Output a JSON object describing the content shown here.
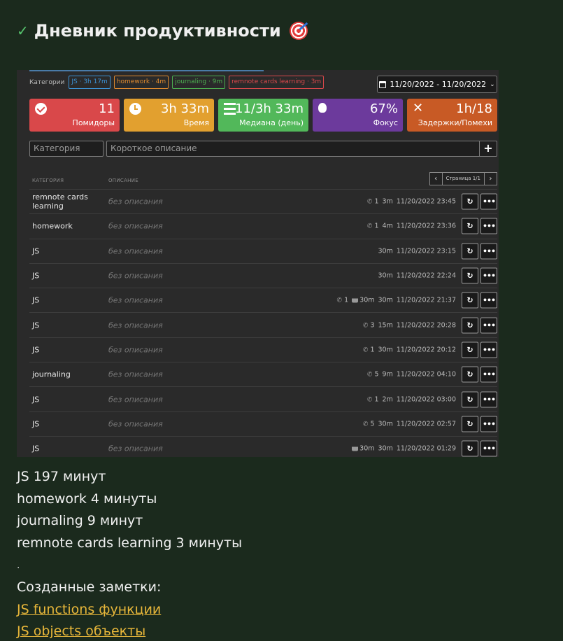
{
  "page": {
    "title": "Дневник продуктивности",
    "check_icon": "check-icon",
    "emoji_icon": "target-icon"
  },
  "app": {
    "categories_label": "Категории",
    "chips": [
      {
        "label": "JS · 3h 17m",
        "color": "#3d93d6"
      },
      {
        "label": "homework · 4m",
        "color": "#e08a2e"
      },
      {
        "label": "journaling · 9m",
        "color": "#4caf50"
      },
      {
        "label": "remnote cards learning · 3m",
        "color": "#d9484a"
      }
    ],
    "date_range": "11/20/2022 - 11/20/2022",
    "stats": [
      {
        "value": "11",
        "label": "Помидоры",
        "icon": "check-circle-icon",
        "color": "#d9484a"
      },
      {
        "value": "3h 33m",
        "label": "Время",
        "icon": "clock-icon",
        "color": "#e2a02f"
      },
      {
        "value": "11/3h 33m",
        "label": "Медиана (день)",
        "icon": "list-icon",
        "color": "#52b85a"
      },
      {
        "value": "67%",
        "label": "Фокус",
        "icon": "lightbulb-icon",
        "color": "#6c3a9c"
      },
      {
        "value": "1h/18",
        "label": "Задержки/Помехи",
        "icon": "x-icon",
        "color": "#c85a25"
      }
    ],
    "category_placeholder": "Категория",
    "description_placeholder": "Короткое описание",
    "add_label": "+",
    "table": {
      "col_category": "КАТЕГОРИЯ",
      "col_description": "ОПИСАНИЕ",
      "pager_prev": "‹",
      "pager_text": "Страница 1/1",
      "pager_next": "›",
      "rows": [
        {
          "category": "remnote cards learning",
          "description": "без описания",
          "interruptions": "1",
          "break": "",
          "duration": "3m",
          "timestamp": "11/20/2022 23:45"
        },
        {
          "category": "homework",
          "description": "без описания",
          "interruptions": "1",
          "break": "",
          "duration": "4m",
          "timestamp": "11/20/2022 23:36"
        },
        {
          "category": "JS",
          "description": "без описания",
          "interruptions": "",
          "break": "",
          "duration": "30m",
          "timestamp": "11/20/2022 23:15"
        },
        {
          "category": "JS",
          "description": "без описания",
          "interruptions": "",
          "break": "",
          "duration": "30m",
          "timestamp": "11/20/2022 22:24"
        },
        {
          "category": "JS",
          "description": "без описания",
          "interruptions": "1",
          "break": "30m",
          "duration": "30m",
          "timestamp": "11/20/2022 21:37"
        },
        {
          "category": "JS",
          "description": "без описания",
          "interruptions": "3",
          "break": "",
          "duration": "15m",
          "timestamp": "11/20/2022 20:28"
        },
        {
          "category": "JS",
          "description": "без описания",
          "interruptions": "1",
          "break": "",
          "duration": "30m",
          "timestamp": "11/20/2022 20:12"
        },
        {
          "category": "journaling",
          "description": "без описания",
          "interruptions": "5",
          "break": "",
          "duration": "9m",
          "timestamp": "11/20/2022 04:10"
        },
        {
          "category": "JS",
          "description": "без описания",
          "interruptions": "1",
          "break": "",
          "duration": "2m",
          "timestamp": "11/20/2022 03:00"
        },
        {
          "category": "JS",
          "description": "без описания",
          "interruptions": "5",
          "break": "",
          "duration": "30m",
          "timestamp": "11/20/2022 02:57"
        },
        {
          "category": "JS",
          "description": "без описания",
          "interruptions": "",
          "break": "30m",
          "duration": "30m",
          "timestamp": "11/20/2022 01:29"
        }
      ]
    }
  },
  "summary": {
    "lines": [
      "JS 197 минут",
      "homework 4 минуты",
      "journaling 9 минут",
      "remnote cards learning 3 минуты"
    ],
    "separator": ".",
    "notes_heading": "Созданные заметки:",
    "links": [
      "JS functions функции",
      "JS objects объекты"
    ]
  }
}
